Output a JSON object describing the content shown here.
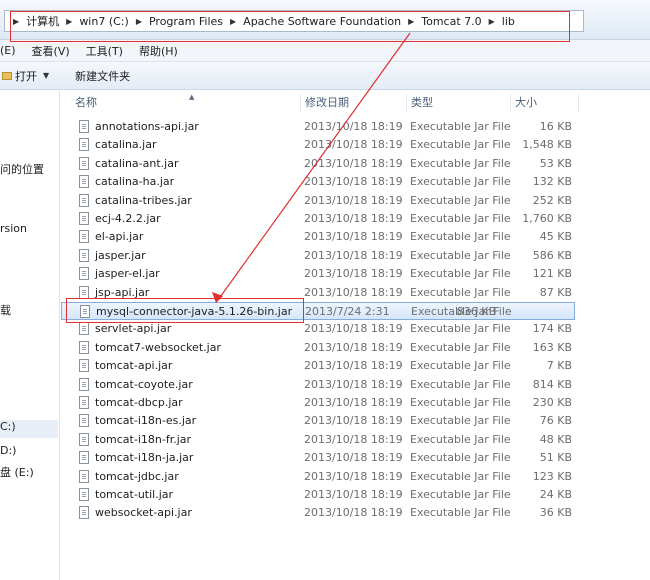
{
  "address_bar": {
    "crumbs": [
      "计算机",
      "win7 (C:)",
      "Program Files",
      "Apache Software Foundation",
      "Tomcat 7.0",
      "lib"
    ]
  },
  "menu": {
    "items": [
      "(E)",
      "查看(V)",
      "工具(T)",
      "帮助(H)"
    ]
  },
  "toolbar": {
    "open_label": "打开",
    "new_folder_label": "新建文件夹"
  },
  "nav_pane": {
    "items": [
      "问的位置",
      "rsion",
      "载",
      "C:)",
      "D:)",
      "盘 (E:)"
    ]
  },
  "columns": {
    "name": "名称",
    "date": "修改日期",
    "type": "类型",
    "size": "大小"
  },
  "files": [
    {
      "name": "annotations-api.jar",
      "date": "2013/10/18 18:19",
      "type": "Executable Jar File",
      "size": "16 KB"
    },
    {
      "name": "catalina.jar",
      "date": "2013/10/18 18:19",
      "type": "Executable Jar File",
      "size": "1,548 KB"
    },
    {
      "name": "catalina-ant.jar",
      "date": "2013/10/18 18:19",
      "type": "Executable Jar File",
      "size": "53 KB"
    },
    {
      "name": "catalina-ha.jar",
      "date": "2013/10/18 18:19",
      "type": "Executable Jar File",
      "size": "132 KB"
    },
    {
      "name": "catalina-tribes.jar",
      "date": "2013/10/18 18:19",
      "type": "Executable Jar File",
      "size": "252 KB"
    },
    {
      "name": "ecj-4.2.2.jar",
      "date": "2013/10/18 18:19",
      "type": "Executable Jar File",
      "size": "1,760 KB"
    },
    {
      "name": "el-api.jar",
      "date": "2013/10/18 18:19",
      "type": "Executable Jar File",
      "size": "45 KB"
    },
    {
      "name": "jasper.jar",
      "date": "2013/10/18 18:19",
      "type": "Executable Jar File",
      "size": "586 KB"
    },
    {
      "name": "jasper-el.jar",
      "date": "2013/10/18 18:19",
      "type": "Executable Jar File",
      "size": "121 KB"
    },
    {
      "name": "jsp-api.jar",
      "date": "2013/10/18 18:19",
      "type": "Executable Jar File",
      "size": "87 KB"
    },
    {
      "name": "mysql-connector-java-5.1.26-bin.jar",
      "date": "2013/7/24 2:31",
      "type": "Executable Jar File",
      "size": "836 KB"
    },
    {
      "name": "servlet-api.jar",
      "date": "2013/10/18 18:19",
      "type": "Executable Jar File",
      "size": "174 KB"
    },
    {
      "name": "tomcat7-websocket.jar",
      "date": "2013/10/18 18:19",
      "type": "Executable Jar File",
      "size": "163 KB"
    },
    {
      "name": "tomcat-api.jar",
      "date": "2013/10/18 18:19",
      "type": "Executable Jar File",
      "size": "7 KB"
    },
    {
      "name": "tomcat-coyote.jar",
      "date": "2013/10/18 18:19",
      "type": "Executable Jar File",
      "size": "814 KB"
    },
    {
      "name": "tomcat-dbcp.jar",
      "date": "2013/10/18 18:19",
      "type": "Executable Jar File",
      "size": "230 KB"
    },
    {
      "name": "tomcat-i18n-es.jar",
      "date": "2013/10/18 18:19",
      "type": "Executable Jar File",
      "size": "76 KB"
    },
    {
      "name": "tomcat-i18n-fr.jar",
      "date": "2013/10/18 18:19",
      "type": "Executable Jar File",
      "size": "48 KB"
    },
    {
      "name": "tomcat-i18n-ja.jar",
      "date": "2013/10/18 18:19",
      "type": "Executable Jar File",
      "size": "51 KB"
    },
    {
      "name": "tomcat-jdbc.jar",
      "date": "2013/10/18 18:19",
      "type": "Executable Jar File",
      "size": "123 KB"
    },
    {
      "name": "tomcat-util.jar",
      "date": "2013/10/18 18:19",
      "type": "Executable Jar File",
      "size": "24 KB"
    },
    {
      "name": "websocket-api.jar",
      "date": "2013/10/18 18:19",
      "type": "Executable Jar File",
      "size": "36 KB"
    }
  ],
  "selected_file_index": 10,
  "colors": {
    "annotation": "#e03030",
    "selection_border": "#84acdd"
  }
}
